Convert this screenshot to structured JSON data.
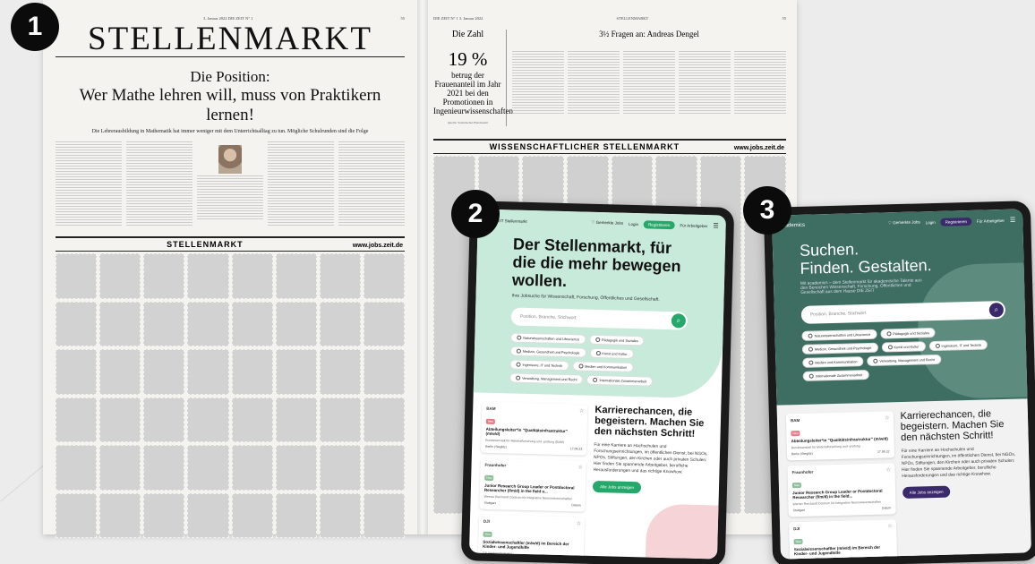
{
  "colors": {
    "green_accent": "#27a86b",
    "green_hero": "#c8eada",
    "dark_teal": "#3e6e62",
    "purple_accent": "#3b2a6b",
    "pink_tag": "#e57c86"
  },
  "badges": [
    "1",
    "2",
    "3"
  ],
  "newspaper": {
    "left": {
      "folio_left": "",
      "folio_mid": "3. Januar 2022   DIE ZEIT N° 1",
      "folio_right": "55",
      "masthead": "STELLENMARKT",
      "kicker": "Die Position:",
      "headline": "Wer Mathe lehren will, muss von Praktikern lernen!",
      "deck": "Die Lehrerausbildung in Mathematik hat immer weniger mit dem Unterrichtsalltag zu tun. Mögliche Schulrunden sind die Folge",
      "ad_title": "STELLENMARKT",
      "ad_url": "www.jobs.zeit.de"
    },
    "right": {
      "folio_left": "DIE ZEIT N° 1   3. Januar 2022",
      "folio_mid": "STELLENMARKT",
      "folio_right": "55",
      "zahl_label": "Die Zahl",
      "zahl_value": "19 %",
      "zahl_text": "betrug der Frauenanteil im Jahr 2021 bei den Promotionen in Ingenieurwissenschaften",
      "zahl_source": "Quelle: Statistisches Bundesamt",
      "fragen_title": "3½ Fragen an: Andreas Dengel",
      "ad_title": "WISSENSCHAFTLICHER STELLENMARKT",
      "ad_url": "www.jobs.zeit.de"
    }
  },
  "tablet2": {
    "logo": "ZEIT Stellenmarkt",
    "nav": {
      "saved": "Gemerkte Jobs",
      "login": "Login",
      "register": "Registrieren",
      "employers": "Für Arbeitgeber"
    },
    "hero_title": "Der Stellenmarkt, für die die mehr bewegen wollen.",
    "hero_sub": "Ihre Jobsuche für Wissenschaft, Forschung, Öffentliches und Gesellschaft.",
    "search_placeholder": "Position, Branche, Stichwort",
    "chips": [
      "Naturwissenschaften und Lifescience",
      "Pädagogik und Soziales",
      "Medizin, Gesundheit und Psychologie",
      "Kunst und Kultur",
      "Ingenieure, IT und Technik",
      "Medien und Kommunikation",
      "Verwaltung, Management und Recht",
      "Internationale Zusammenarbeit"
    ],
    "jobs": [
      {
        "org": "BAM",
        "tag": "Neu",
        "title": "Abteilungsleiter*in \"Qualitätsinfrastruktur\" (m/w/d)",
        "meta": "Bundesanstalt für Materialforschung und -prüfung (BAM)",
        "city": "Berlin (Steglitz)",
        "date": "17.06.22"
      },
      {
        "org": "Fraunhofer",
        "tag": "Neu",
        "title": "Junior Research Group Leader or Postdoctoral Researcher (f/m/d) in the field o...",
        "meta": "Werner Reichardt Centrum für Integrative Neurowissenschaften",
        "city": "Stuttgart",
        "date": "Datum"
      },
      {
        "org": "DJI",
        "tag": "Neu",
        "title": "Sozialwissenschaftler (m/w/d) im Bereich der Kinder- und Jugendhilfe",
        "meta": "DJI Kinderschutz e.V.",
        "city": "München",
        "date": "08.06.22"
      }
    ],
    "career_title": "Karrierechancen, die begeistern. Machen Sie den nächsten Schritt!",
    "career_text": "Für eine Karriere an Hochschulen und Forschungseinrichtungen, im öffentlichen Dienst, bei NGOs, NPOs, Stiftungen, den Kirchen oder auch privaten Schulen: Hier finden Sie spannende Arbeitgeber, berufliche Herausforderungen und das richtige Knowhow.",
    "career_cta": "Alle Jobs anzeigen"
  },
  "tablet3": {
    "logo": "academics",
    "nav": {
      "saved": "Gemerkte Jobs",
      "login": "Login",
      "register": "Registrieren",
      "employers": "Für Arbeitgeber"
    },
    "hero_title_1": "Suchen.",
    "hero_title_2": "Finden. Gestalten.",
    "hero_sub": "Mit academics – dem Stellenmarkt für akademische Talente aus den Bereichen Wissenschaft, Forschung, Öffentliches und Gesellschaft aus dem Hause DIE ZEIT",
    "search_placeholder": "Position, Branche, Stichwort",
    "chips": [
      "Naturwissenschaften und Lifescience",
      "Pädagogik und Soziales",
      "Medizin, Gesundheit und Psychologie",
      "Kunst und Kultur",
      "Ingenieure, IT und Technik",
      "Medien und Kommunikation",
      "Verwaltung, Management und Recht",
      "Internationale Zusammenarbeit"
    ],
    "jobs": [
      {
        "org": "BAM",
        "tag": "Neu",
        "title": "Abteilungsleiter*in \"Qualitätsinfrastruktur\" (m/w/d)",
        "meta": "Bundesanstalt für Materialforschung und -prüfung",
        "city": "Berlin (Steglitz)",
        "date": "17.06.22"
      },
      {
        "org": "Fraunhofer",
        "tag": "Neu",
        "title": "Junior Research Group Leader or Postdoctoral Researcher (f/m/d) in the field...",
        "meta": "Werner Reichardt Centrum für Integrative Neurowissenschaften",
        "city": "Stuttgart",
        "date": "Datum"
      },
      {
        "org": "DJI",
        "tag": "Neu",
        "title": "Sozialwissenschaftler (m/w/d) im Bereich der Kinder- und Jugendhilfe",
        "meta": "DJI Kinderschutz e.V.",
        "city": "",
        "date": ""
      }
    ],
    "career_title": "Karrierechancen, die begeistern. Machen Sie den nächsten Schritt!",
    "career_text": "Für eine Karriere an Hochschulen und Forschungseinrichtungen, im öffentlichen Dienst, bei NGOs, NPOs, Stiftungen, den Kirchen oder auch privaten Schulen: Hier finden Sie spannende Arbeitgeber, berufliche Herausforderungen und das richtige Knowhow.",
    "career_cta": "Alle Jobs anzeigen"
  }
}
